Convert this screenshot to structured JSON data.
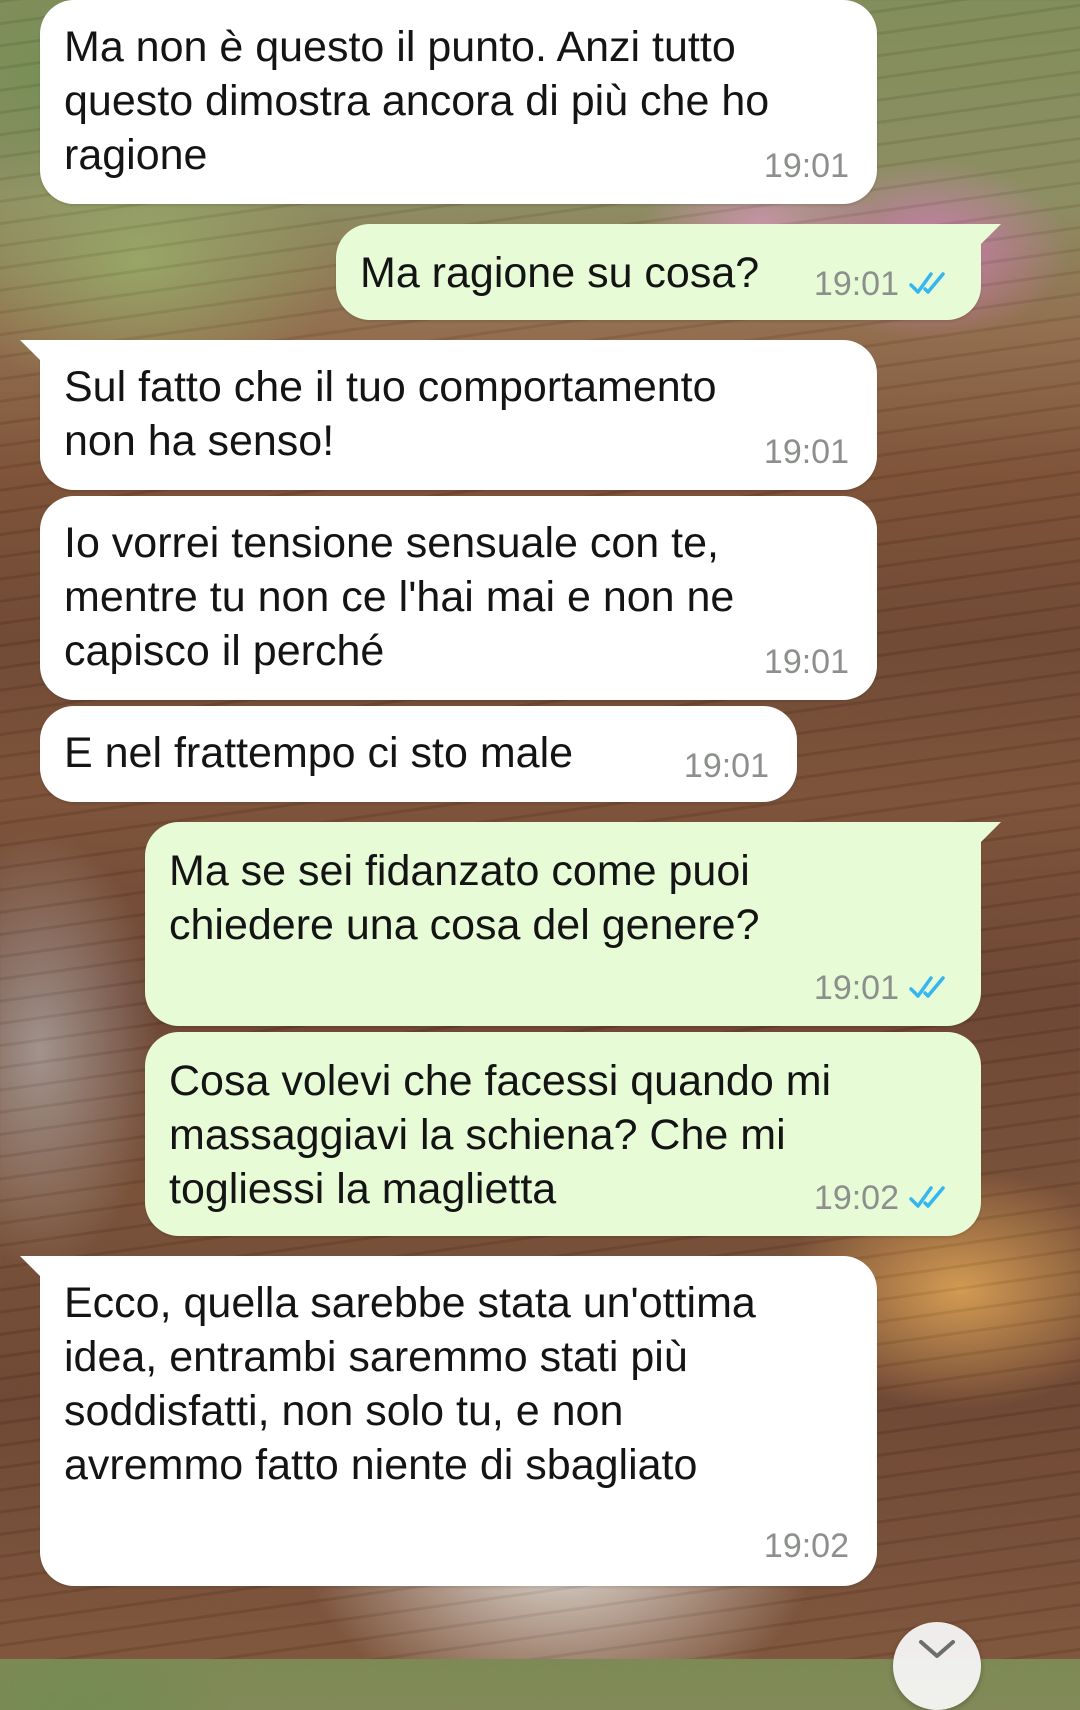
{
  "messages": [
    {
      "direction": "incoming",
      "text": "Ma non è questo il punto. Anzi tutto\nquesto dimostra ancora di più che ho\nragione",
      "time": "19:01"
    },
    {
      "direction": "outgoing",
      "text": "Ma ragione su cosa?",
      "time": "19:01",
      "status": "read"
    },
    {
      "direction": "incoming",
      "text": "Sul fatto che il tuo comportamento\nnon ha senso!",
      "time": "19:01"
    },
    {
      "direction": "incoming",
      "text": "Io vorrei tensione sensuale con te,\nmentre tu non ce l'hai mai e non ne\ncapisco il perché",
      "time": "19:01"
    },
    {
      "direction": "incoming",
      "text": "E nel frattempo ci sto male",
      "time": "19:01"
    },
    {
      "direction": "outgoing",
      "text": "Ma se sei fidanzato come puoi\nchiedere una cosa del genere?",
      "time": "19:01",
      "status": "read"
    },
    {
      "direction": "outgoing",
      "text": "Cosa volevi che facessi quando mi\nmassaggiavi la schiena? Che mi\ntogliessi la maglietta",
      "time": "19:02",
      "status": "read"
    },
    {
      "direction": "incoming",
      "text": "Ecco, quella sarebbe stata un'ottima\nidea, entrambi saremmo stati più\nsoddisfatti, non solo tu, e non\navremmo fatto niente di sbagliato",
      "time": "19:02"
    }
  ],
  "icons": {
    "read_receipt": "double-check-icon",
    "scroll_down": "chevron-down-icon"
  },
  "colors": {
    "incoming_bubble": "#ffffff",
    "outgoing_bubble": "#e7fbd7",
    "read_tick": "#34b7f1",
    "timestamp": "#8c8f8c"
  }
}
